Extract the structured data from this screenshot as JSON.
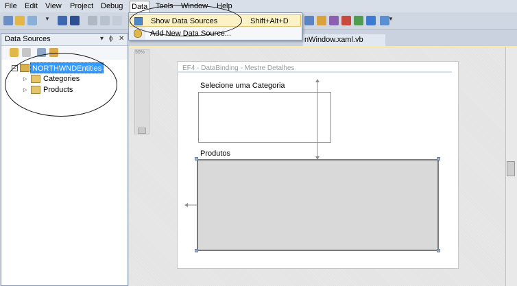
{
  "menubar": {
    "items": [
      "File",
      "Edit",
      "View",
      "Project",
      "Debug",
      "Data",
      "Tools",
      "Window",
      "Help"
    ]
  },
  "data_menu": {
    "items": [
      {
        "label": "Show Data Sources",
        "shortcut": "Shift+Alt+D",
        "highlighted": true
      },
      {
        "label": "Add New Data Source...",
        "shortcut": "",
        "highlighted": false
      }
    ]
  },
  "document_tab": {
    "label": "nWindow.xaml.vb"
  },
  "data_sources": {
    "title": "Data Sources",
    "pin_icon": "pin-icon",
    "close_icon": "close-icon",
    "tree": {
      "root": "NORTHWNDEntities",
      "children": [
        "Categories",
        "Products"
      ]
    }
  },
  "designer": {
    "zoom": "90%",
    "window_title": "EF4 - DataBinding - Mestre Detalhes",
    "category_label": "Selecione uma Categoria",
    "products_label": "Produtos"
  },
  "colors": {
    "menu_highlight": "#fdf2c5",
    "tree_selection": "#3399ff",
    "panel_border": "#8a99b0"
  }
}
